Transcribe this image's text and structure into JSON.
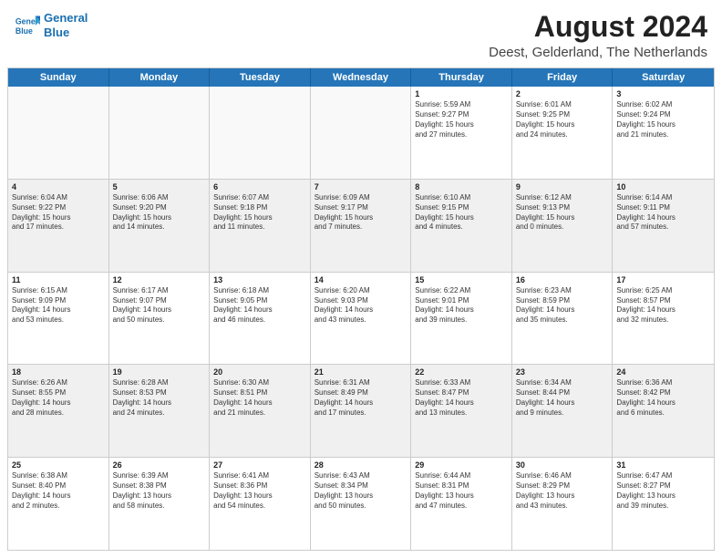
{
  "logo": {
    "line1": "General",
    "line2": "Blue"
  },
  "header": {
    "title": "August 2024",
    "subtitle": "Deest, Gelderland, The Netherlands"
  },
  "weekdays": [
    "Sunday",
    "Monday",
    "Tuesday",
    "Wednesday",
    "Thursday",
    "Friday",
    "Saturday"
  ],
  "rows": [
    [
      {
        "day": "",
        "lines": [],
        "empty": true
      },
      {
        "day": "",
        "lines": [],
        "empty": true
      },
      {
        "day": "",
        "lines": [],
        "empty": true
      },
      {
        "day": "",
        "lines": [],
        "empty": true
      },
      {
        "day": "1",
        "lines": [
          "Sunrise: 5:59 AM",
          "Sunset: 9:27 PM",
          "Daylight: 15 hours",
          "and 27 minutes."
        ]
      },
      {
        "day": "2",
        "lines": [
          "Sunrise: 6:01 AM",
          "Sunset: 9:25 PM",
          "Daylight: 15 hours",
          "and 24 minutes."
        ]
      },
      {
        "day": "3",
        "lines": [
          "Sunrise: 6:02 AM",
          "Sunset: 9:24 PM",
          "Daylight: 15 hours",
          "and 21 minutes."
        ]
      }
    ],
    [
      {
        "day": "4",
        "lines": [
          "Sunrise: 6:04 AM",
          "Sunset: 9:22 PM",
          "Daylight: 15 hours",
          "and 17 minutes."
        ],
        "shaded": true
      },
      {
        "day": "5",
        "lines": [
          "Sunrise: 6:06 AM",
          "Sunset: 9:20 PM",
          "Daylight: 15 hours",
          "and 14 minutes."
        ],
        "shaded": true
      },
      {
        "day": "6",
        "lines": [
          "Sunrise: 6:07 AM",
          "Sunset: 9:18 PM",
          "Daylight: 15 hours",
          "and 11 minutes."
        ],
        "shaded": true
      },
      {
        "day": "7",
        "lines": [
          "Sunrise: 6:09 AM",
          "Sunset: 9:17 PM",
          "Daylight: 15 hours",
          "and 7 minutes."
        ],
        "shaded": true
      },
      {
        "day": "8",
        "lines": [
          "Sunrise: 6:10 AM",
          "Sunset: 9:15 PM",
          "Daylight: 15 hours",
          "and 4 minutes."
        ],
        "shaded": true
      },
      {
        "day": "9",
        "lines": [
          "Sunrise: 6:12 AM",
          "Sunset: 9:13 PM",
          "Daylight: 15 hours",
          "and 0 minutes."
        ],
        "shaded": true
      },
      {
        "day": "10",
        "lines": [
          "Sunrise: 6:14 AM",
          "Sunset: 9:11 PM",
          "Daylight: 14 hours",
          "and 57 minutes."
        ],
        "shaded": true
      }
    ],
    [
      {
        "day": "11",
        "lines": [
          "Sunrise: 6:15 AM",
          "Sunset: 9:09 PM",
          "Daylight: 14 hours",
          "and 53 minutes."
        ]
      },
      {
        "day": "12",
        "lines": [
          "Sunrise: 6:17 AM",
          "Sunset: 9:07 PM",
          "Daylight: 14 hours",
          "and 50 minutes."
        ]
      },
      {
        "day": "13",
        "lines": [
          "Sunrise: 6:18 AM",
          "Sunset: 9:05 PM",
          "Daylight: 14 hours",
          "and 46 minutes."
        ]
      },
      {
        "day": "14",
        "lines": [
          "Sunrise: 6:20 AM",
          "Sunset: 9:03 PM",
          "Daylight: 14 hours",
          "and 43 minutes."
        ]
      },
      {
        "day": "15",
        "lines": [
          "Sunrise: 6:22 AM",
          "Sunset: 9:01 PM",
          "Daylight: 14 hours",
          "and 39 minutes."
        ]
      },
      {
        "day": "16",
        "lines": [
          "Sunrise: 6:23 AM",
          "Sunset: 8:59 PM",
          "Daylight: 14 hours",
          "and 35 minutes."
        ]
      },
      {
        "day": "17",
        "lines": [
          "Sunrise: 6:25 AM",
          "Sunset: 8:57 PM",
          "Daylight: 14 hours",
          "and 32 minutes."
        ]
      }
    ],
    [
      {
        "day": "18",
        "lines": [
          "Sunrise: 6:26 AM",
          "Sunset: 8:55 PM",
          "Daylight: 14 hours",
          "and 28 minutes."
        ],
        "shaded": true
      },
      {
        "day": "19",
        "lines": [
          "Sunrise: 6:28 AM",
          "Sunset: 8:53 PM",
          "Daylight: 14 hours",
          "and 24 minutes."
        ],
        "shaded": true
      },
      {
        "day": "20",
        "lines": [
          "Sunrise: 6:30 AM",
          "Sunset: 8:51 PM",
          "Daylight: 14 hours",
          "and 21 minutes."
        ],
        "shaded": true
      },
      {
        "day": "21",
        "lines": [
          "Sunrise: 6:31 AM",
          "Sunset: 8:49 PM",
          "Daylight: 14 hours",
          "and 17 minutes."
        ],
        "shaded": true
      },
      {
        "day": "22",
        "lines": [
          "Sunrise: 6:33 AM",
          "Sunset: 8:47 PM",
          "Daylight: 14 hours",
          "and 13 minutes."
        ],
        "shaded": true
      },
      {
        "day": "23",
        "lines": [
          "Sunrise: 6:34 AM",
          "Sunset: 8:44 PM",
          "Daylight: 14 hours",
          "and 9 minutes."
        ],
        "shaded": true
      },
      {
        "day": "24",
        "lines": [
          "Sunrise: 6:36 AM",
          "Sunset: 8:42 PM",
          "Daylight: 14 hours",
          "and 6 minutes."
        ],
        "shaded": true
      }
    ],
    [
      {
        "day": "25",
        "lines": [
          "Sunrise: 6:38 AM",
          "Sunset: 8:40 PM",
          "Daylight: 14 hours",
          "and 2 minutes."
        ]
      },
      {
        "day": "26",
        "lines": [
          "Sunrise: 6:39 AM",
          "Sunset: 8:38 PM",
          "Daylight: 13 hours",
          "and 58 minutes."
        ]
      },
      {
        "day": "27",
        "lines": [
          "Sunrise: 6:41 AM",
          "Sunset: 8:36 PM",
          "Daylight: 13 hours",
          "and 54 minutes."
        ]
      },
      {
        "day": "28",
        "lines": [
          "Sunrise: 6:43 AM",
          "Sunset: 8:34 PM",
          "Daylight: 13 hours",
          "and 50 minutes."
        ]
      },
      {
        "day": "29",
        "lines": [
          "Sunrise: 6:44 AM",
          "Sunset: 8:31 PM",
          "Daylight: 13 hours",
          "and 47 minutes."
        ]
      },
      {
        "day": "30",
        "lines": [
          "Sunrise: 6:46 AM",
          "Sunset: 8:29 PM",
          "Daylight: 13 hours",
          "and 43 minutes."
        ]
      },
      {
        "day": "31",
        "lines": [
          "Sunrise: 6:47 AM",
          "Sunset: 8:27 PM",
          "Daylight: 13 hours",
          "and 39 minutes."
        ]
      }
    ]
  ]
}
